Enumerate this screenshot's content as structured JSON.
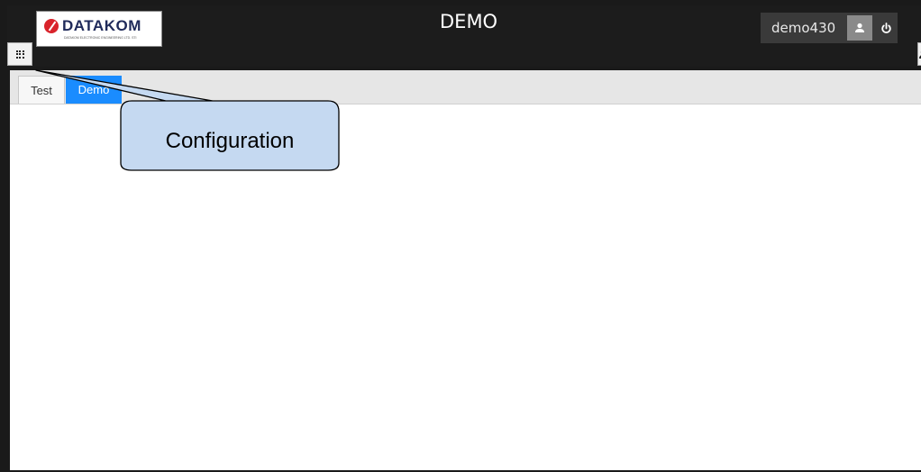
{
  "header": {
    "logo": {
      "text": "DATAKOM",
      "subtext": "DATAKOM ELECTRONIC ENGINEERING LTD. STI"
    },
    "title": "DEMO",
    "user": {
      "name": "demo430"
    },
    "icons": {
      "menu": "grid-menu-icon",
      "user": "user-icon",
      "power": "power-icon"
    }
  },
  "tabs": [
    {
      "label": "Test",
      "active": false
    },
    {
      "label": "Demo",
      "active": true
    }
  ],
  "annotation": {
    "label": "Configuration",
    "fill": "#c5d9f1"
  },
  "colors": {
    "accent": "#1a8cff",
    "frame": "#1a1a1a"
  }
}
